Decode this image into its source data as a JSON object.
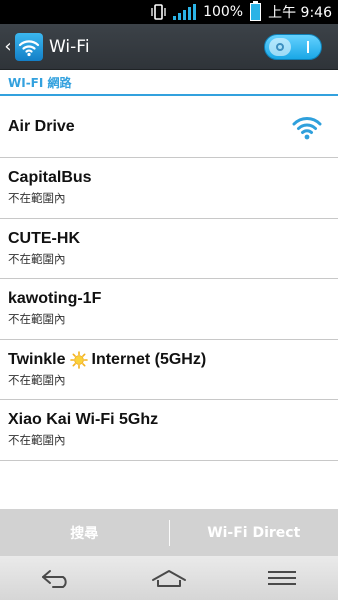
{
  "status_bar": {
    "battery": "100%",
    "time": "上午 9:46"
  },
  "action_bar": {
    "title": "Wi-Fi",
    "toggle_state": "on"
  },
  "section": {
    "title": "WI-FI 網路"
  },
  "networks": [
    {
      "ssid": "Air Drive",
      "status": ""
    },
    {
      "ssid": "CapitalBus",
      "status": "不在範圍內"
    },
    {
      "ssid": "CUTE-HK",
      "status": "不在範圍內"
    },
    {
      "ssid": "kawoting-1F",
      "status": "不在範圍內"
    },
    {
      "ssid_pre": "Twinkle",
      "ssid_post": "Internet (5GHz)",
      "status": "不在範圍內"
    },
    {
      "ssid": "Xiao Kai Wi-Fi 5Ghz",
      "status": "不在範圍內"
    }
  ],
  "bottom_bar": {
    "search": "搜尋",
    "wifi_direct": "Wi-Fi Direct"
  },
  "colors": {
    "accent": "#33a1de",
    "actionbar": "#363b40"
  }
}
